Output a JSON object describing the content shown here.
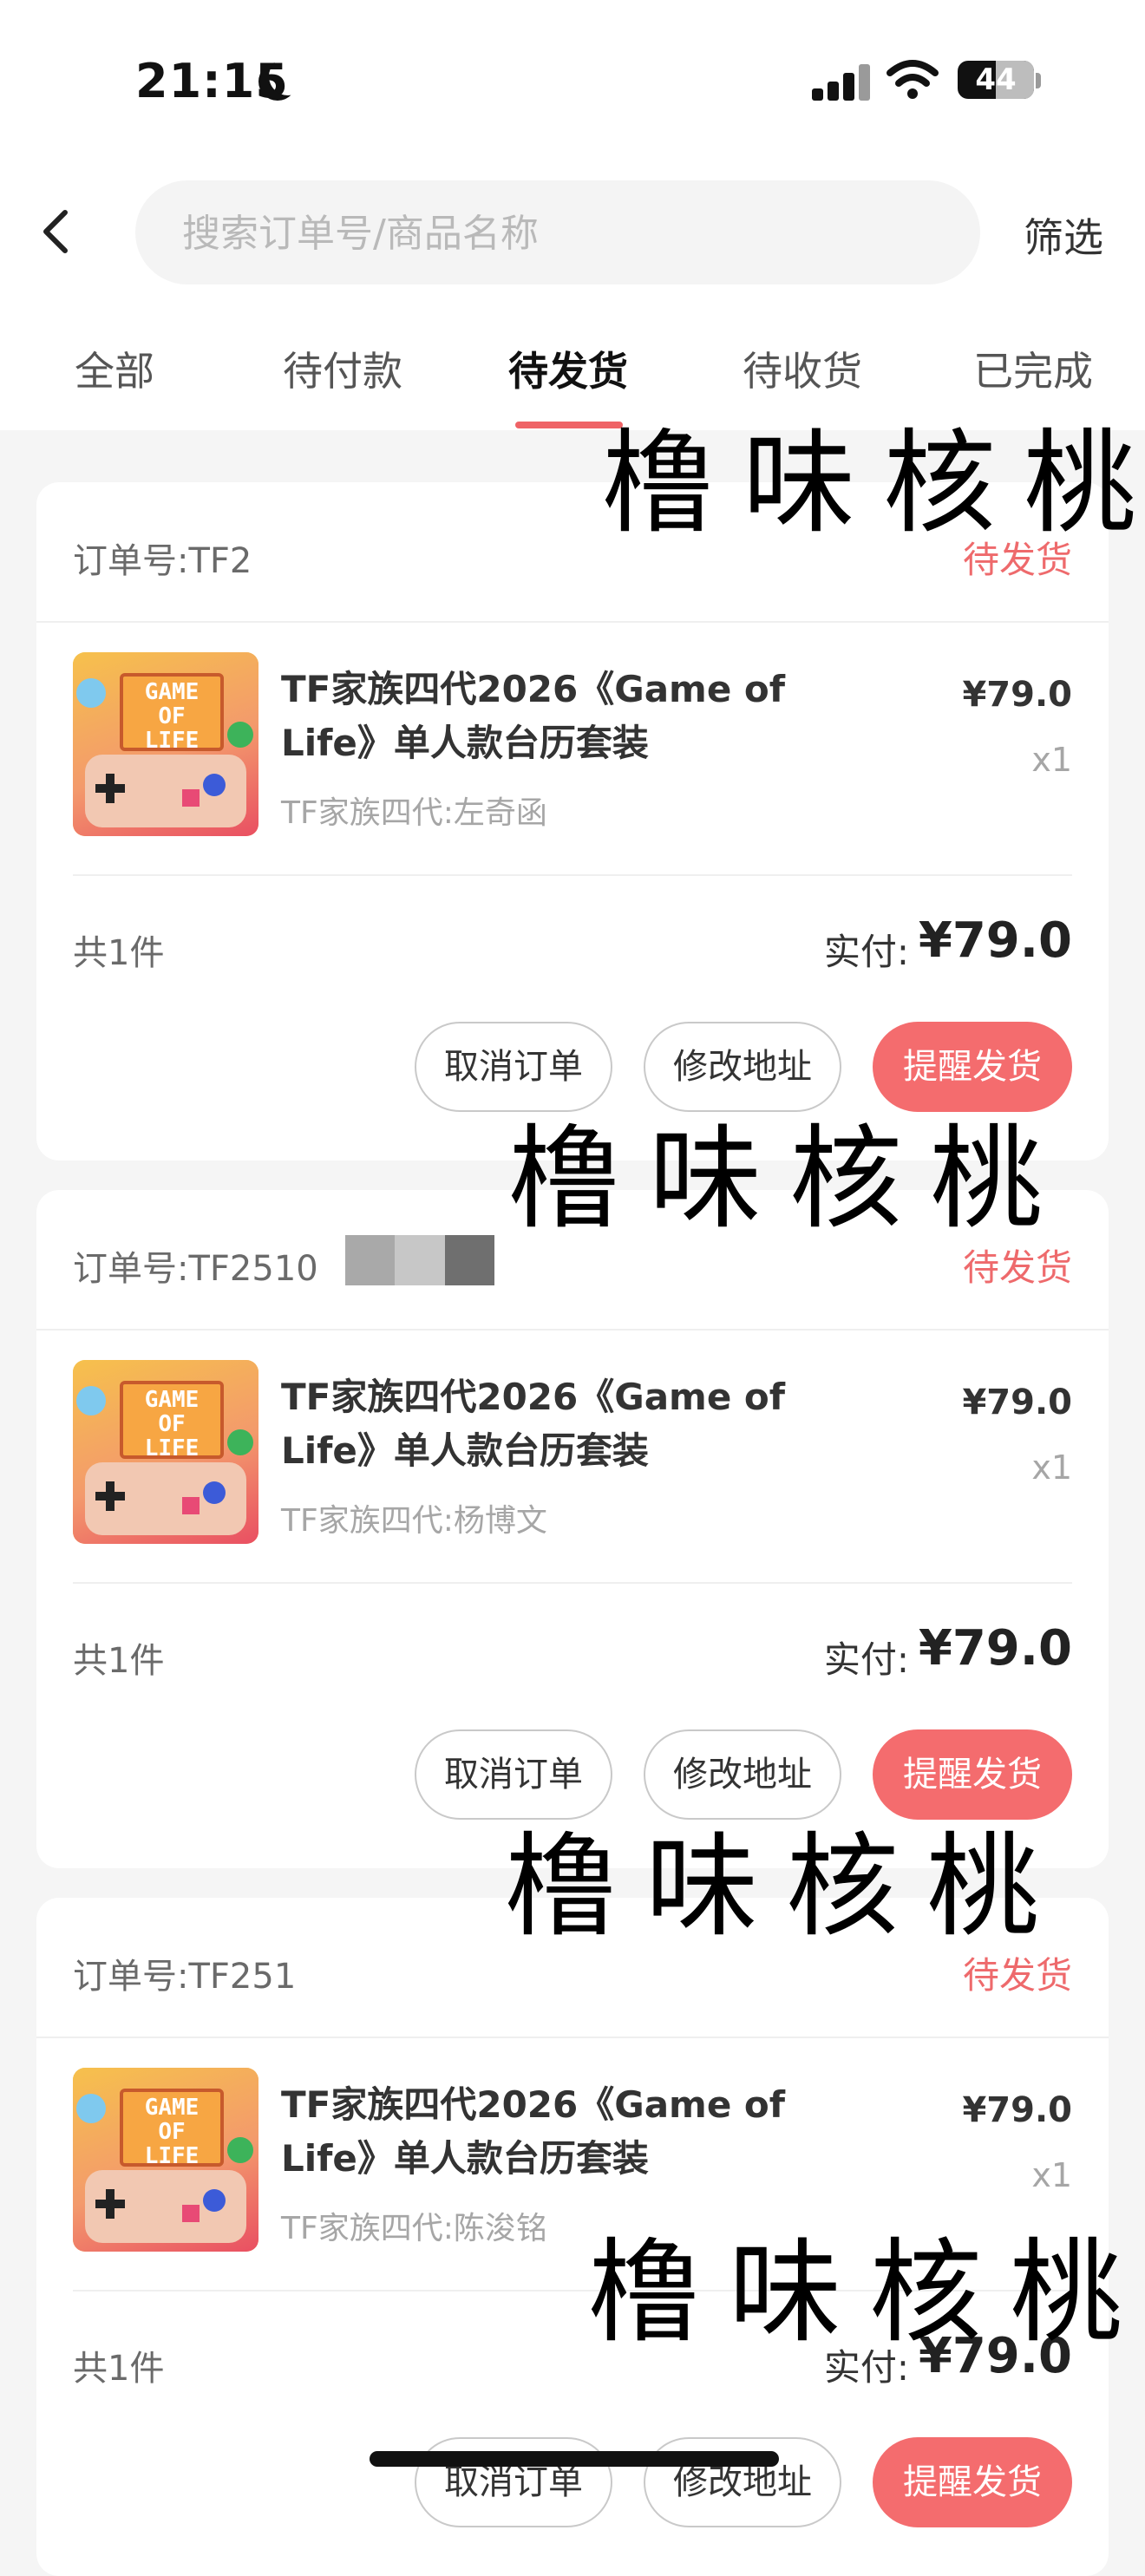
{
  "status_bar": {
    "time": "21:15",
    "battery": "44"
  },
  "search": {
    "placeholder": "搜索订单号/商品名称",
    "filter_label": "筛选"
  },
  "tabs": [
    {
      "label": "全部"
    },
    {
      "label": "待付款"
    },
    {
      "label": "待发货"
    },
    {
      "label": "待收货"
    },
    {
      "label": "已完成"
    }
  ],
  "active_tab": "待发货",
  "orders": [
    {
      "order_no": "订单号:TF2",
      "status": "待发货",
      "product_title": "TF家族四代2026《Game of Life》单人款台历套装",
      "variant": "TF家族四代:左奇函",
      "price": "¥79.0",
      "qty": "x1",
      "count": "共1件",
      "paid_label": "实付:",
      "paid_value": "¥79.0",
      "buttons": {
        "cancel": "取消订单",
        "address": "修改地址",
        "remind": "提醒发货"
      }
    },
    {
      "order_no": "订单号:TF2510",
      "status": "待发货",
      "product_title": "TF家族四代2026《Game of Life》单人款台历套装",
      "variant": "TF家族四代:杨博文",
      "price": "¥79.0",
      "qty": "x1",
      "count": "共1件",
      "paid_label": "实付:",
      "paid_value": "¥79.0",
      "buttons": {
        "cancel": "取消订单",
        "address": "修改地址",
        "remind": "提醒发货"
      }
    },
    {
      "order_no": "订单号:TF251",
      "status": "待发货",
      "product_title": "TF家族四代2026《Game of Life》单人款台历套装",
      "variant": "TF家族四代:陈浚铭",
      "price": "¥79.0",
      "qty": "x1",
      "count": "共1件",
      "paid_label": "实付:",
      "paid_value": "¥79.0",
      "buttons": {
        "cancel": "取消订单",
        "address": "修改地址",
        "remind": "提醒发货"
      }
    }
  ],
  "thumbnail_text": "GAME OF LIFE",
  "watermark": "橹味核桃",
  "colors": {
    "accent": "#f46c6e",
    "status_text": "#ee6a6c",
    "background": "#f5f5f5"
  }
}
